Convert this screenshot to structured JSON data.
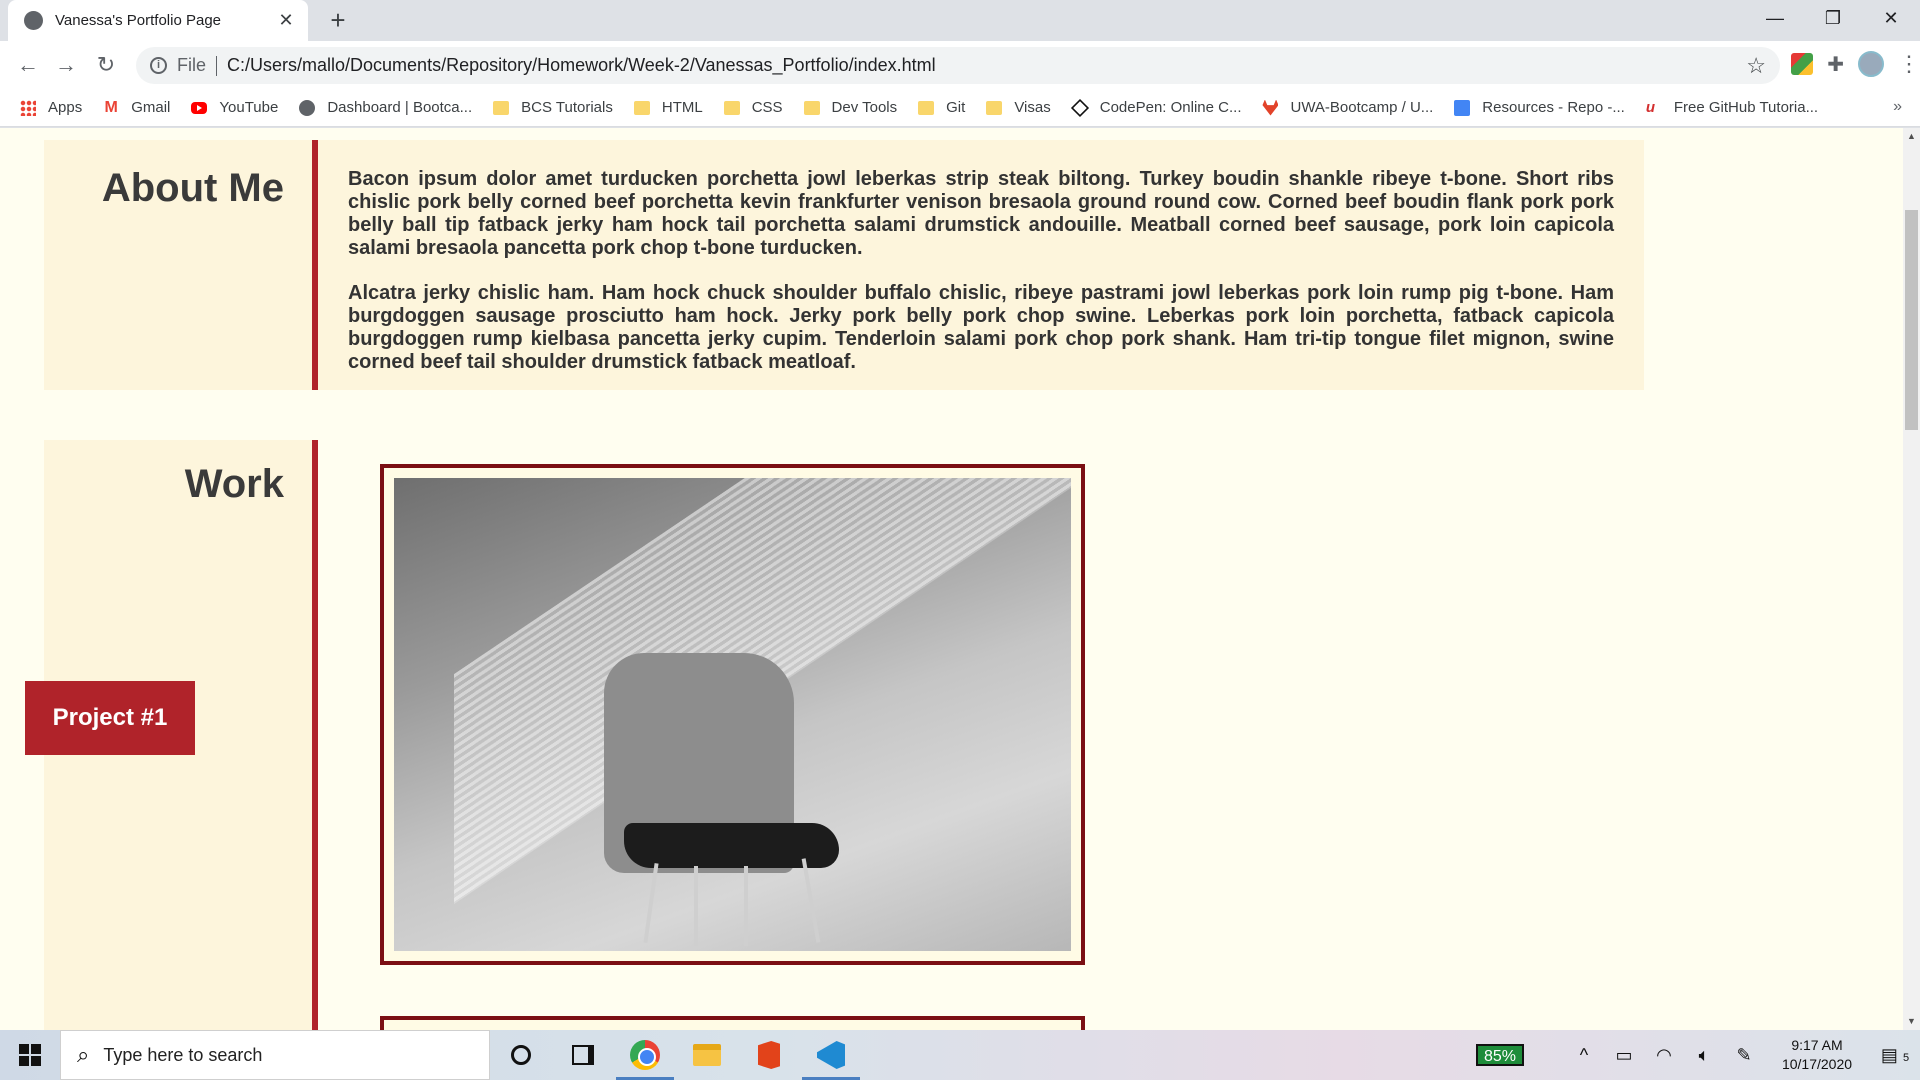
{
  "browser": {
    "tab_title": "Vanessa's Portfolio Page",
    "tab_close": "✕",
    "new_tab": "+",
    "scheme_label": "File",
    "url": "C:/Users/mallo/Documents/Repository/Homework/Week-2/Vanessas_Portfolio/index.html",
    "window_controls": {
      "minimize": "—",
      "restore": "❐",
      "close": "✕"
    }
  },
  "bookmarks": [
    {
      "label": "Apps",
      "icon": "apps-grid-icon"
    },
    {
      "label": "Gmail",
      "icon": "gmail-icon"
    },
    {
      "label": "YouTube",
      "icon": "youtube-icon"
    },
    {
      "label": "Dashboard | Bootca...",
      "icon": "globe-icon"
    },
    {
      "label": "BCS Tutorials",
      "icon": "folder-icon"
    },
    {
      "label": "HTML",
      "icon": "folder-icon"
    },
    {
      "label": "CSS",
      "icon": "folder-icon"
    },
    {
      "label": "Dev Tools",
      "icon": "folder-icon"
    },
    {
      "label": "Git",
      "icon": "folder-icon"
    },
    {
      "label": "Visas",
      "icon": "folder-icon"
    },
    {
      "label": "CodePen: Online C...",
      "icon": "codepen-icon"
    },
    {
      "label": "UWA-Bootcamp / U...",
      "icon": "gitlab-icon"
    },
    {
      "label": "Resources - Repo -...",
      "icon": "docs-icon"
    },
    {
      "label": "Free GitHub Tutoria...",
      "icon": "github-tutorial-icon"
    }
  ],
  "bookmarks_more": "»",
  "page": {
    "about": {
      "heading": "About Me",
      "paragraphs": [
        "Bacon ipsum dolor amet turducken porchetta jowl leberkas strip steak biltong. Turkey boudin shankle ribeye t-bone. Short ribs chislic pork belly corned beef porchetta kevin frankfurter venison bresaola ground round cow. Corned beef boudin flank pork pork belly ball tip fatback jerky ham hock tail porchetta salami drumstick andouille. Meatball corned beef sausage, pork loin capicola salami bresaola pancetta pork chop t-bone turducken.",
        "Alcatra jerky chislic ham. Ham hock chuck shoulder buffalo chislic, ribeye pastrami jowl leberkas pork loin rump pig t-bone. Ham burgdoggen sausage prosciutto ham hock. Jerky pork belly pork chop swine. Leberkas pork loin porchetta, fatback capicola burgdoggen rump kielbasa pancetta jerky cupim. Tenderloin salami pork chop pork shank. Ham tri-tip tongue filet mignon, swine corned beef tail shoulder drumstick fatback meatloaf."
      ]
    },
    "work": {
      "heading": "Work",
      "project_button": "Project #1"
    }
  },
  "taskbar": {
    "search_placeholder": "Type here to search",
    "battery": "85%",
    "time": "9:17 AM",
    "date": "10/17/2020",
    "notifications_count": "5"
  },
  "colors": {
    "accent": "#b0232a",
    "frame": "#7b0f13",
    "page_background": "#fffef0",
    "panel_background": "#fdf5dc"
  }
}
